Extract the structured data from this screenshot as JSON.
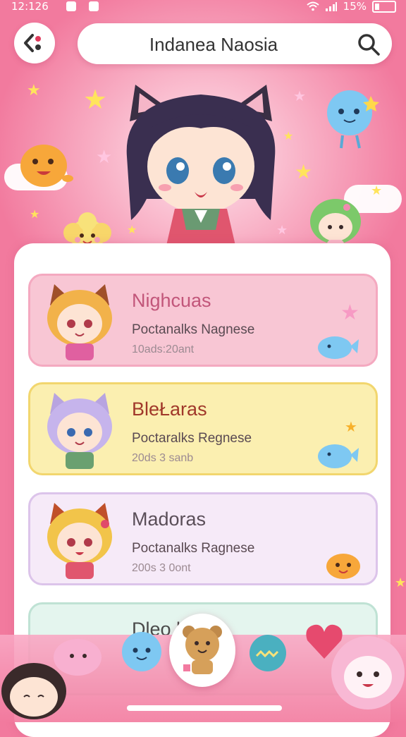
{
  "status_bar": {
    "time": "12:126",
    "battery": "15%"
  },
  "header": {
    "title": "Indanea Naosia"
  },
  "icons": {
    "back": "back-arrow-icon",
    "search": "search-icon"
  },
  "list": [
    {
      "name": "Nighcuas",
      "subtitle": "Poctanalks Nagnese",
      "meta": "10ads:20ant",
      "theme": "pink",
      "name_color": "#c2567a"
    },
    {
      "name": "BleŁaras",
      "subtitle": "Poctaralks Regnese",
      "meta": "20ds 3 sanb",
      "theme": "yellow",
      "name_color": "#a0382a"
    },
    {
      "name": "Madoras",
      "subtitle": "Poctanalks Ragnese",
      "meta": "200s 3 0ont",
      "theme": "lavender",
      "name_color": "#5a4e58"
    },
    {
      "name": "Dleo l",
      "subtitle": "",
      "meta": "",
      "theme": "mint",
      "name_color": "#4a4a4a"
    }
  ],
  "colors": {
    "accent": "#f27a9e",
    "card_pink": "#f8c6d4",
    "card_yellow": "#fbefb0",
    "card_lavender": "#f6eaf8",
    "card_mint": "#e4f5ee"
  }
}
